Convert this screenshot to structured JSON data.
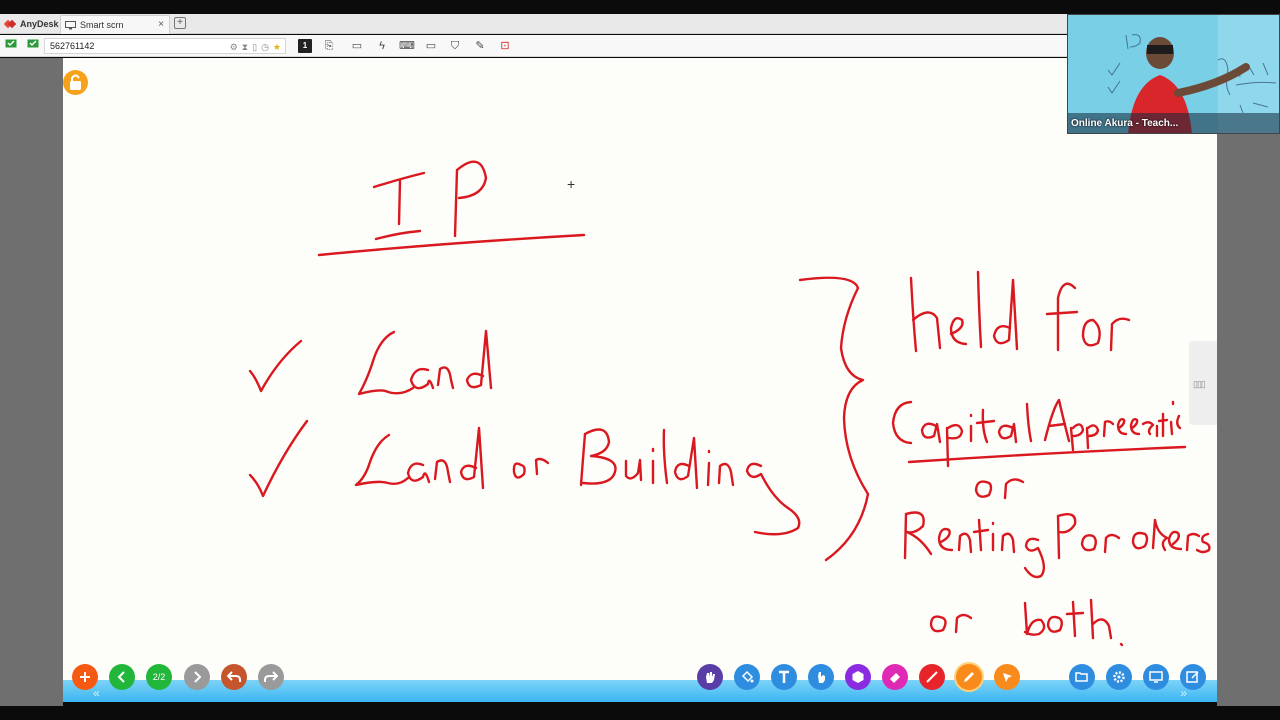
{
  "app": {
    "brand": "AnyDesk",
    "tab_title": "Smart scrn",
    "tab_close": "×",
    "new_tab": "+",
    "address": "562761142",
    "monitor_label": "1"
  },
  "board": {
    "page_indicator": "2/2"
  },
  "video": {
    "caption": "Online Akura - Teach..."
  },
  "colors": {
    "ink": "#d9181f",
    "accent_orange": "#f7a21b",
    "bar_blue": "#3ab6f0"
  },
  "bottom_tools_left": [
    "add-icon",
    "prev-page-icon",
    "page-indicator",
    "next-page-icon",
    "undo-icon",
    "redo-icon"
  ],
  "bottom_tools_right": [
    "hand-icon",
    "fill-icon",
    "text-icon",
    "pointer-icon",
    "shape-icon",
    "eraser-icon",
    "line-icon",
    "pen-icon",
    "laser-icon",
    "folder-icon",
    "settings-icon",
    "screen-icon",
    "edit-icon"
  ]
}
